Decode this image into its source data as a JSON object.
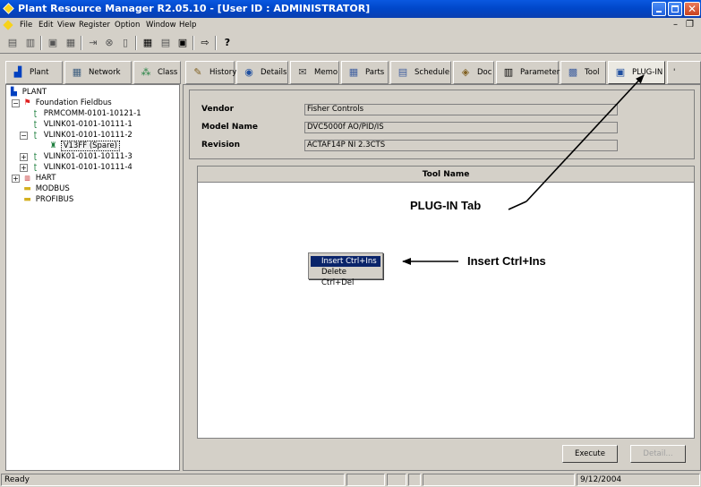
{
  "window": {
    "title": "Plant Resource Manager R2.05.10 - [User ID : ADMINISTRATOR]"
  },
  "menu": [
    "File",
    "Edit",
    "View",
    "Register",
    "Option",
    "Window",
    "Help"
  ],
  "left_tabs": [
    {
      "label": "Plant",
      "icon": "plant-icon"
    },
    {
      "label": "Network",
      "icon": "network-icon"
    },
    {
      "label": "Class",
      "icon": "class-icon"
    }
  ],
  "right_tabs": [
    {
      "label": "History",
      "icon": "history-icon"
    },
    {
      "label": "Details",
      "icon": "details-icon"
    },
    {
      "label": "Memo",
      "icon": "memo-icon"
    },
    {
      "label": "Parts",
      "icon": "parts-icon"
    },
    {
      "label": "Schedule",
      "icon": "schedule-icon"
    },
    {
      "label": "Doc",
      "icon": "doc-icon"
    },
    {
      "label": "Parameter",
      "icon": "parameter-icon"
    },
    {
      "label": "Tool",
      "icon": "tool-icon"
    },
    {
      "label": "PLUG-IN",
      "icon": "plugin-icon",
      "active": true
    }
  ],
  "tree": {
    "root": "PLANT",
    "foundation": "Foundation Fieldbus",
    "items": [
      "PRMCOMM-0101-10121-1",
      "VLINK01-0101-10111-1",
      "VLINK01-0101-10111-2",
      "V13FF (Spare)",
      "VLINK01-0101-10111-3",
      "VLINK01-0101-10111-4"
    ],
    "hart": "HART",
    "modbus": "MODBUS",
    "profibus": "PROFIBUS"
  },
  "info": {
    "vendor_label": "Vendor",
    "vendor_value": "Fisher Controls",
    "model_label": "Model Name",
    "model_value": "DVC5000f AO/PID/IS",
    "revision_label": "Revision",
    "revision_value": "ACTAF14P NI 2.3CTS"
  },
  "tool_grid": {
    "header": "Tool Name"
  },
  "context_menu": {
    "insert": "Insert  Ctrl+Ins",
    "delete": "Delete  Ctrl+Del"
  },
  "buttons": {
    "execute": "Execute",
    "detail": "Detail..."
  },
  "status": {
    "text": "Ready",
    "date": "9/12/2004"
  },
  "annotations": {
    "plugin_tab": "PLUG-IN Tab",
    "insert": "Insert Ctrl+Ins"
  }
}
